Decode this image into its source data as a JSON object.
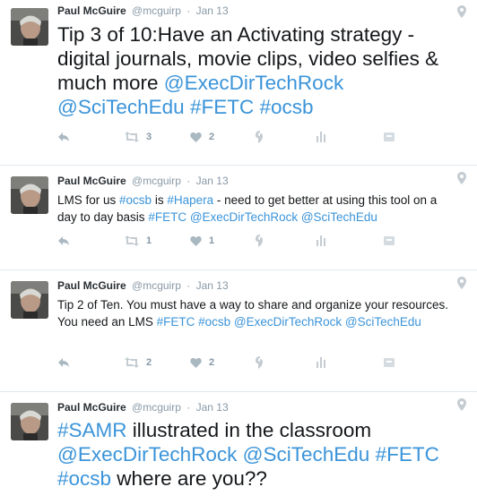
{
  "tweets": [
    {
      "name": "Paul McGuire",
      "handle": "@mcguirp",
      "sep": "·",
      "date": "Jan 13",
      "size": "big",
      "segments": [
        {
          "t": "text",
          "v": "Tip 3 of 10:Have an Activating strategy - digital journals, movie clips, video selfies & much more "
        },
        {
          "t": "ment",
          "v": "@ExecDirTechRock"
        },
        {
          "t": "text",
          "v": " "
        },
        {
          "t": "ment",
          "v": "@SciTechEdu"
        },
        {
          "t": "text",
          "v": " "
        },
        {
          "t": "tag",
          "v": "#FETC"
        },
        {
          "t": "text",
          "v": " "
        },
        {
          "t": "tag",
          "v": "#ocsb"
        }
      ],
      "retweets": "3",
      "likes": "2"
    },
    {
      "name": "Paul McGuire",
      "handle": "@mcguirp",
      "sep": "·",
      "date": "Jan 13",
      "size": "small",
      "segments": [
        {
          "t": "text",
          "v": "LMS for us "
        },
        {
          "t": "tag",
          "v": "#ocsb"
        },
        {
          "t": "text",
          "v": " is "
        },
        {
          "t": "tag",
          "v": "#Hapera"
        },
        {
          "t": "text",
          "v": " - need to get better at using this tool on a day to day basis "
        },
        {
          "t": "tag",
          "v": "#FETC"
        },
        {
          "t": "text",
          "v": " "
        },
        {
          "t": "ment",
          "v": "@ExecDirTechRock"
        },
        {
          "t": "text",
          "v": "  "
        },
        {
          "t": "ment",
          "v": "@SciTechEdu"
        }
      ],
      "retweets": "1",
      "likes": "1"
    },
    {
      "name": "Paul McGuire",
      "handle": "@mcguirp",
      "sep": "·",
      "date": "Jan 13",
      "size": "small",
      "segments": [
        {
          "t": "text",
          "v": "Tip 2 of Ten.  You must have a way to share and organize your resources.  You need an LMS  "
        },
        {
          "t": "tag",
          "v": "#FETC"
        },
        {
          "t": "text",
          "v": " "
        },
        {
          "t": "tag",
          "v": "#ocsb"
        },
        {
          "t": "text",
          "v": " "
        },
        {
          "t": "ment",
          "v": "@ExecDirTechRock"
        },
        {
          "t": "text",
          "v": " "
        },
        {
          "t": "ment",
          "v": "@SciTechEdu"
        }
      ],
      "retweets": "2",
      "likes": "2"
    },
    {
      "name": "Paul McGuire",
      "handle": "@mcguirp",
      "sep": "·",
      "date": "Jan 13",
      "size": "big",
      "segments": [
        {
          "t": "tag",
          "v": "#SAMR"
        },
        {
          "t": "text",
          "v": " illustrated in the classroom "
        },
        {
          "t": "ment",
          "v": "@ExecDirTechRock"
        },
        {
          "t": "text",
          "v": " "
        },
        {
          "t": "ment",
          "v": "@SciTechEdu"
        },
        {
          "t": "text",
          "v": " "
        },
        {
          "t": "tag",
          "v": "#FETC"
        },
        {
          "t": "text",
          "v": " "
        },
        {
          "t": "tag",
          "v": "#ocsb"
        },
        {
          "t": "text",
          "v": " where are you??"
        }
      ],
      "retweets": "",
      "likes": ""
    }
  ],
  "icons": {
    "reply": "reply-icon",
    "retweet": "retweet-icon",
    "like": "heart-icon",
    "engage": "engagement-icon",
    "stats": "analytics-icon",
    "more": "more-icon",
    "geo": "location-pin-icon"
  },
  "colors": {
    "link": "#3b94d9",
    "meta": "#8899a6",
    "divider": "#e1e8ed"
  }
}
